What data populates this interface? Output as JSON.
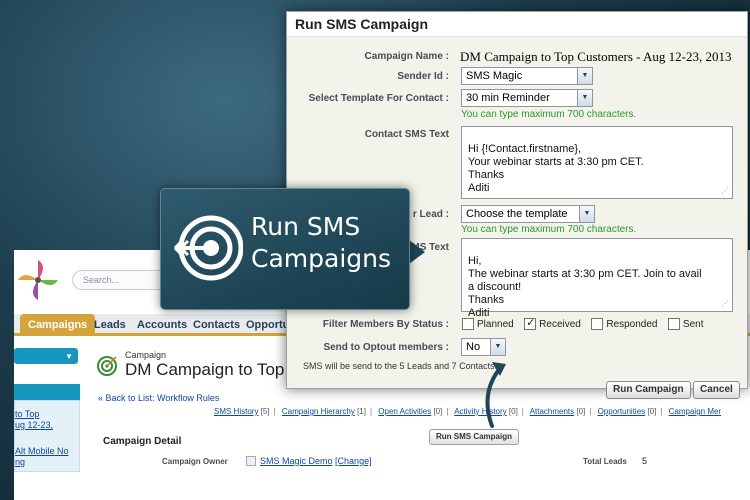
{
  "underlying": {
    "search_placeholder": "Search...",
    "tabs": [
      "Campaigns",
      "Leads",
      "Accounts",
      "Contacts",
      "Opportu"
    ],
    "sidebar_links": [
      "to Top",
      "ug 12-23,",
      "Alt Mobile No",
      "ng"
    ],
    "crumb": "Campaign",
    "title": "DM Campaign to Top C",
    "back_link": "« Back to List: Workflow Rules",
    "related_links": [
      {
        "label": "SMS History",
        "count": "[5]"
      },
      {
        "label": "Campaign Hierarchy",
        "count": "[1]"
      },
      {
        "label": "Open Activities",
        "count": "[0]"
      },
      {
        "label": "Activity History",
        "count": "[0]"
      },
      {
        "label": "Attachments",
        "count": "[0]"
      },
      {
        "label": "Opportunities",
        "count": "[0]"
      },
      {
        "label": "Campaign Mer",
        "count": ""
      }
    ],
    "run_button": "Run SMS Campaign",
    "detail_header": "Campaign Detail",
    "owner_label": "Campaign Owner",
    "owner_value": "SMS Magic Demo",
    "owner_change": "[Change]",
    "total_leads_label": "Total Leads",
    "total_leads_value": "5"
  },
  "modal": {
    "title": "Run SMS Campaign",
    "campaign_name_label": "Campaign Name :",
    "campaign_name_value": "DM Campaign to Top Customers - Aug 12-23, 2013",
    "sender_label": "Sender Id :",
    "sender_value": "SMS Magic",
    "template_contact_label": "Select Template For Contact :",
    "template_contact_value": "30 min Reminder",
    "hint_contact": "You can type maximum 700 characters.",
    "contact_text_label": "Contact SMS Text",
    "contact_text_value": "Hi {!Contact.firstname},\nYour webinar starts at 3:30 pm CET.\nThanks\nAditi",
    "template_lead_label": "r Lead :",
    "template_lead_value": "Choose the template",
    "hint_lead": "You can type maximum 700 characters.",
    "lead_text_label": "MS Text",
    "lead_text_value": "Hi,\nThe webinar starts at 3:30 pm CET. Join to avail\na discount!\nThanks\nAditi",
    "status_label": "Filter Members By Status :",
    "statuses": [
      {
        "label": "Planned",
        "checked": false
      },
      {
        "label": "Received",
        "checked": true
      },
      {
        "label": "Responded",
        "checked": false
      },
      {
        "label": "Sent",
        "checked": false
      }
    ],
    "optout_label": "Send to Optout members :",
    "optout_value": "No",
    "summary": "SMS will be send to the 5 Leads and 7 Contacts.",
    "run_button": "Run Campaign",
    "cancel_button": "Cancel"
  },
  "callout": {
    "text_line1": "Run SMS",
    "text_line2": "Campaigns"
  },
  "colors": {
    "accent_green": "#2a9a2a",
    "callout_bg": "#1f4656",
    "tab_active": "#d4a33b",
    "link": "#0e49a0"
  }
}
